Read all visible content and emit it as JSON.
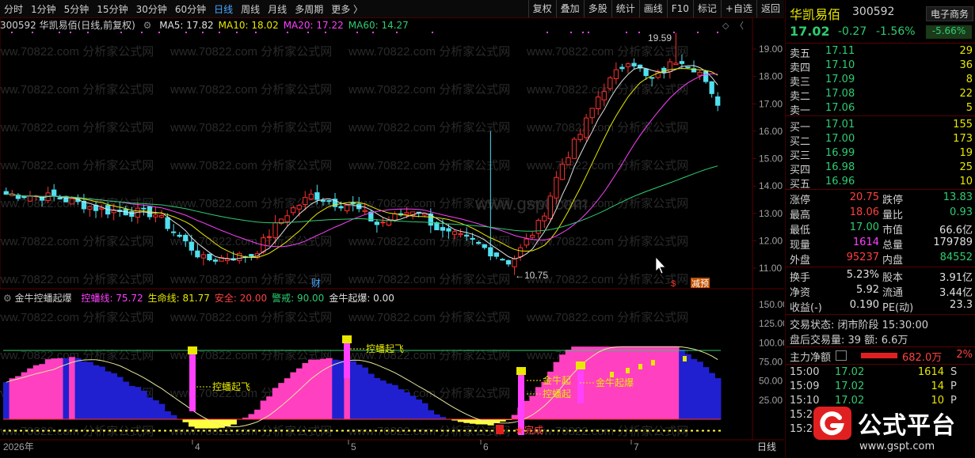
{
  "toolbar": {
    "periods": [
      "分时",
      "1分钟",
      "5分钟",
      "15分钟",
      "30分钟",
      "60分钟",
      "日线",
      "周线",
      "月线",
      "多周期",
      "更多 〉"
    ],
    "active_period": "日线",
    "buttons": [
      "复权",
      "叠加",
      "多股",
      "统计",
      "画线",
      "F10",
      "标记",
      "+自选",
      "返回"
    ]
  },
  "main_chart": {
    "title": "300592 华凯易佰(日线,前复权)",
    "ma": [
      {
        "label": "MA5: 17.82",
        "color": "#e0e0e0"
      },
      {
        "label": "MA10: 18.02",
        "color": "#e8e800"
      },
      {
        "label": "MA20: 17.22",
        "color": "#ff40ff"
      },
      {
        "label": "MA60: 14.27",
        "color": "#2ecc71"
      }
    ],
    "y_ticks": [
      "19.00",
      "18.00",
      "17.00",
      "16.00",
      "15.00",
      "14.00",
      "13.00",
      "12.00",
      "11.00"
    ],
    "high_label": "19.59",
    "low_label": "10.75",
    "marker_cai": "财",
    "marker_s": "$",
    "marker_jian": "减预"
  },
  "indicator": {
    "name": "金牛控蟠起爆",
    "values": [
      {
        "label": "控蟠线: 75.72",
        "color": "#ff40ff"
      },
      {
        "label": "生命线: 81.77",
        "color": "#e8e800"
      },
      {
        "label": "安全: 20.00",
        "color": "#ff4040"
      },
      {
        "label": "警戒: 90.00",
        "color": "#2ecc71"
      },
      {
        "label": "金牛起爆: 0.00",
        "color": "#e0e0e0"
      }
    ],
    "y_ticks": [
      "150.00",
      "125.00",
      "100.00",
      "75.00",
      "50.00",
      "25.00"
    ],
    "annotations": [
      "控蟠起飞",
      "控蟠起飞",
      "金牛起",
      "控蟠起",
      "金牛起爆"
    ],
    "complete_label": "完成"
  },
  "x_axis": {
    "year": "2026年",
    "months": [
      "4",
      "5",
      "6",
      "7"
    ],
    "period_label": "日线"
  },
  "watermarks": [
    "www.70822.com 分析家公式网",
    "www.gspt.com",
    "WWW.GSPT.COM"
  ],
  "quote": {
    "name": "华凯易佰",
    "code": "300592",
    "price": "17.02",
    "change": "-0.27",
    "change_pct": "-1.56%",
    "sector": "电子商务",
    "sector_pct": "-5.66%",
    "asks": [
      {
        "label": "卖五",
        "price": "17.11",
        "vol": "29"
      },
      {
        "label": "卖四",
        "price": "17.10",
        "vol": "36"
      },
      {
        "label": "卖三",
        "price": "17.09",
        "vol": "8"
      },
      {
        "label": "卖二",
        "price": "17.08",
        "vol": "22"
      },
      {
        "label": "卖一",
        "price": "17.06",
        "vol": "5"
      }
    ],
    "bids": [
      {
        "label": "买一",
        "price": "17.01",
        "vol": "155"
      },
      {
        "label": "买二",
        "price": "17.00",
        "vol": "173"
      },
      {
        "label": "买三",
        "price": "16.99",
        "vol": "19"
      },
      {
        "label": "买四",
        "price": "16.98",
        "vol": "25"
      },
      {
        "label": "买五",
        "price": "16.96",
        "vol": "10"
      }
    ],
    "stats1": [
      {
        "k1": "涨停",
        "v1": "20.75",
        "c1": "red",
        "k2": "跌停",
        "v2": "13.83",
        "c2": "green"
      },
      {
        "k1": "最高",
        "v1": "18.06",
        "c1": "red",
        "k2": "量比",
        "v2": "0.93",
        "c2": "green"
      },
      {
        "k1": "最低",
        "v1": "17.00",
        "c1": "green",
        "k2": "市值",
        "v2": "66.6亿",
        "c2": "white"
      },
      {
        "k1": "现量",
        "v1": "1614",
        "c1": "magenta",
        "k2": "总量",
        "v2": "179789",
        "c2": "white"
      },
      {
        "k1": "外盘",
        "v1": "95237",
        "c1": "red",
        "k2": "内盘",
        "v2": "84552",
        "c2": "green"
      }
    ],
    "stats2": [
      {
        "k1": "换手",
        "v1": "5.23%",
        "c1": "white",
        "k2": "股本",
        "v2": "3.91亿",
        "c2": "white"
      },
      {
        "k1": "净资",
        "v1": "5.92",
        "c1": "white",
        "k2": "流通",
        "v2": "3.44亿",
        "c2": "white"
      },
      {
        "k1": "收益(-)",
        "v1": "0.190",
        "c1": "white",
        "k2": "PE(动)",
        "v2": "23.3",
        "c2": "white"
      }
    ],
    "trade_status": "交易状态: 闭市阶段 15:30:00",
    "after_hours": "盘后交易量: 39  额: 6.6万",
    "main_flow_label": "主力净额",
    "main_flow_value": "682.0万",
    "main_flow_pct": "2%",
    "ticks": [
      {
        "time": "15:00",
        "price": "17.02",
        "vol": "1614",
        "flag": "S"
      },
      {
        "time": "15:09",
        "price": "17.02",
        "vol": "14",
        "flag": "P"
      },
      {
        "time": "15:10",
        "price": "17.02",
        "vol": "10",
        "flag": "P"
      },
      {
        "time": "15:2",
        "price": "",
        "vol": "",
        "flag": ""
      },
      {
        "time": "15:2",
        "price": "",
        "vol": "",
        "flag": ""
      }
    ]
  },
  "brand": {
    "name": "公式平台",
    "url": "www.gspt.com"
  }
}
